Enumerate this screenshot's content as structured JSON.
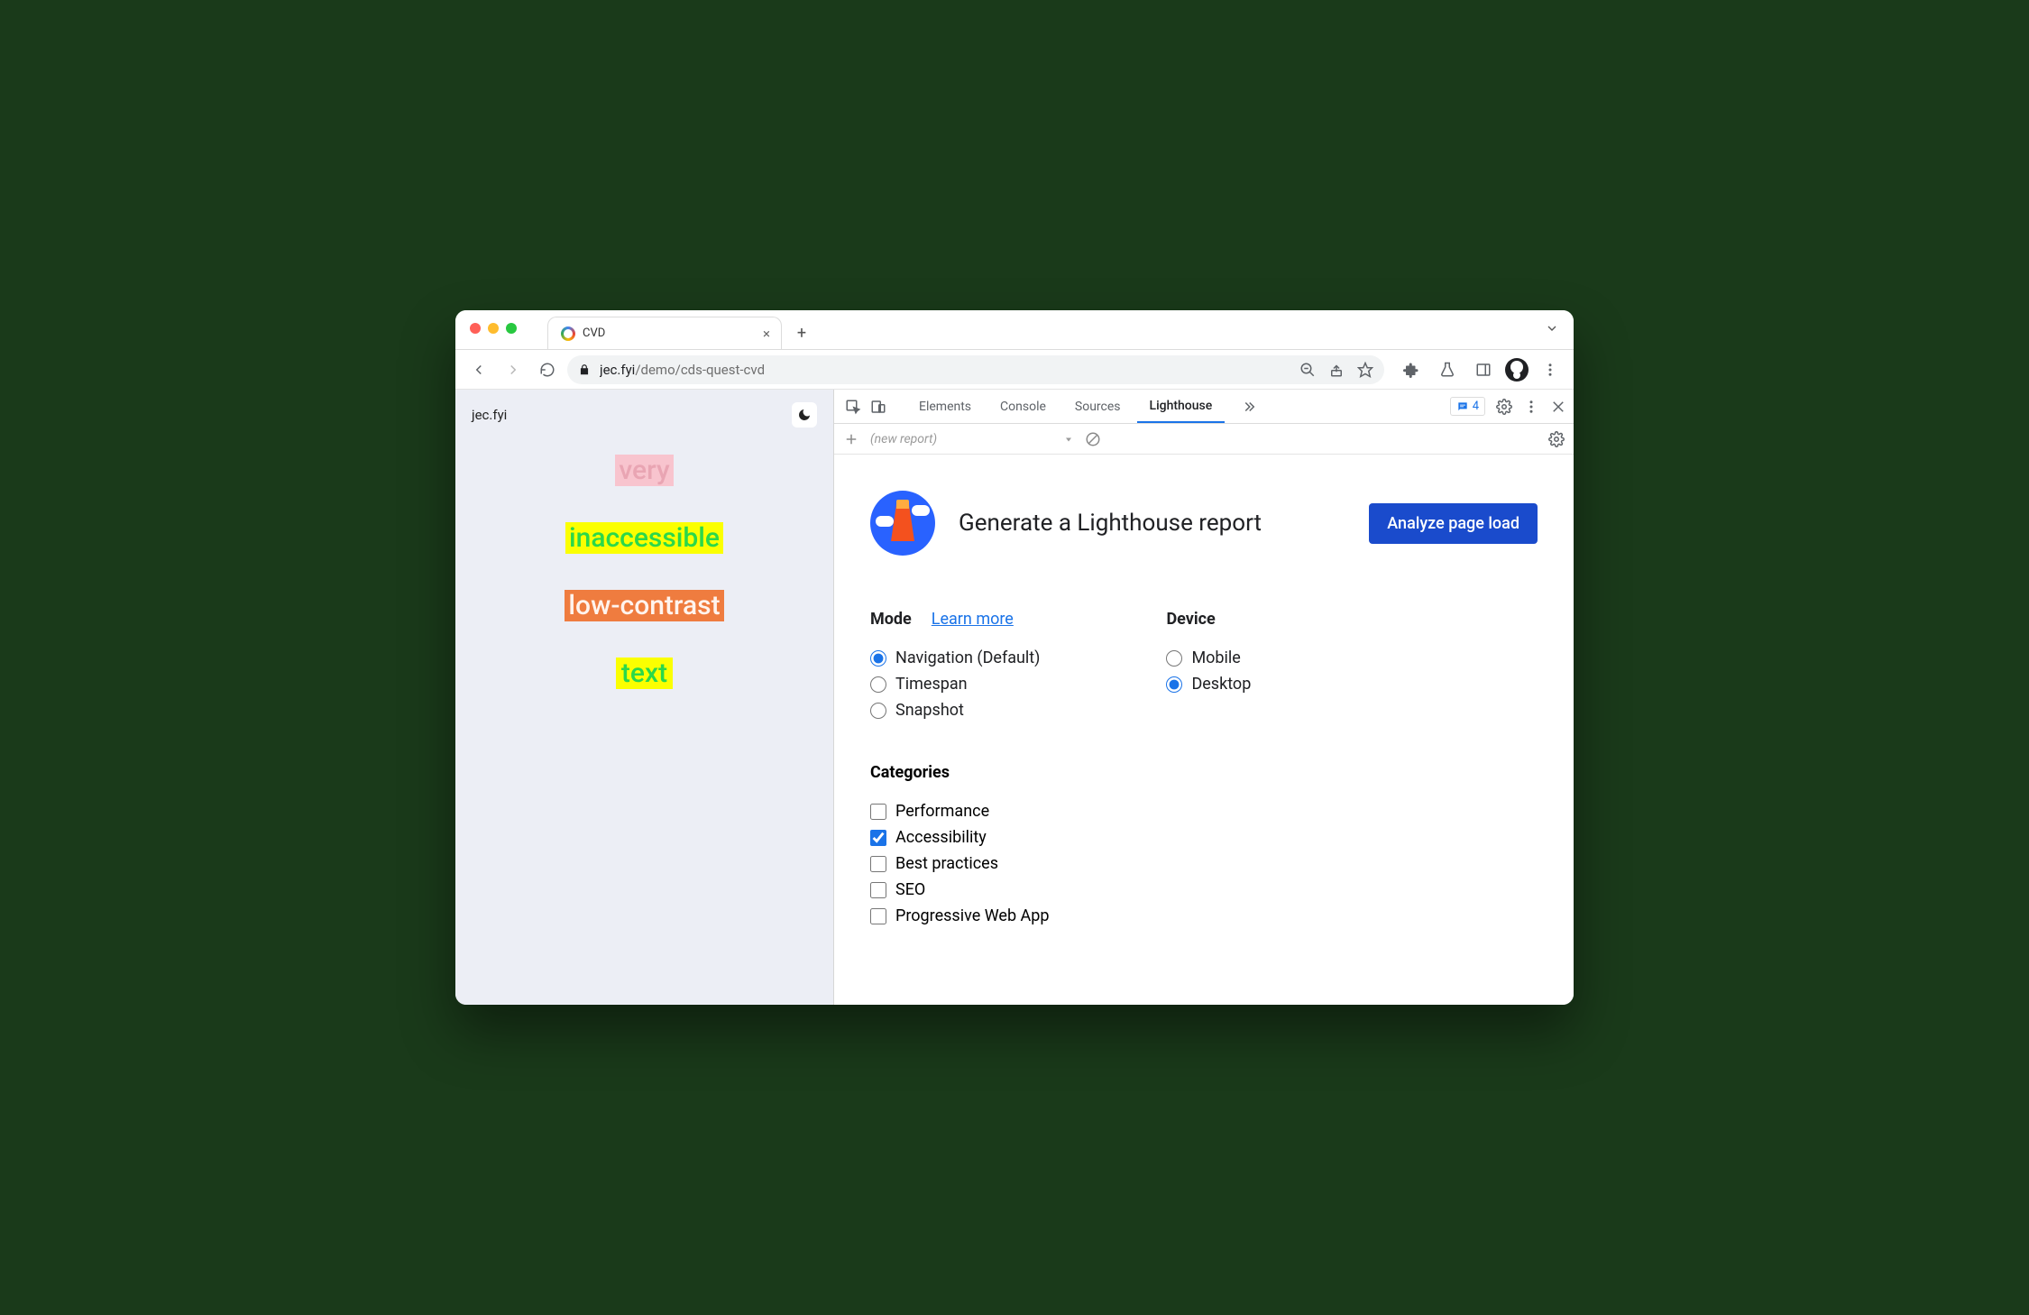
{
  "tab": {
    "title": "CVD"
  },
  "omnibox": {
    "host": "jec.fyi",
    "path": "/demo/cds-quest-cvd"
  },
  "page": {
    "brand": "jec.fyi",
    "words": [
      "very",
      "inaccessible",
      "low-contrast",
      "text"
    ]
  },
  "devtools": {
    "tabs": [
      "Elements",
      "Console",
      "Sources",
      "Lighthouse"
    ],
    "active_tab": "Lighthouse",
    "issues_count": "4",
    "subbar": {
      "new_report": "(new report)"
    }
  },
  "lighthouse": {
    "title": "Generate a Lighthouse report",
    "analyze_label": "Analyze page load",
    "mode": {
      "heading": "Mode",
      "learn_more": "Learn more",
      "options": [
        "Navigation (Default)",
        "Timespan",
        "Snapshot"
      ],
      "selected": "Navigation (Default)"
    },
    "device": {
      "heading": "Device",
      "options": [
        "Mobile",
        "Desktop"
      ],
      "selected": "Desktop"
    },
    "categories": {
      "heading": "Categories",
      "options": [
        "Performance",
        "Accessibility",
        "Best practices",
        "SEO",
        "Progressive Web App"
      ],
      "checked": [
        "Accessibility"
      ]
    }
  }
}
